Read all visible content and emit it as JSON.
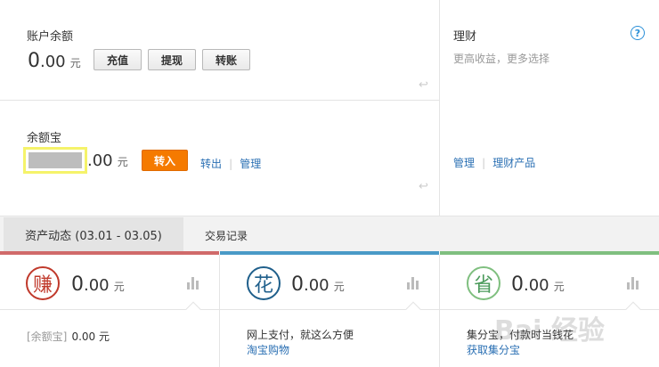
{
  "account": {
    "title": "账户余额",
    "amount_int": "0",
    "amount_dec": ".00",
    "unit": "元",
    "buttons": [
      "充值",
      "提现",
      "转账"
    ]
  },
  "yuebao": {
    "title": "余额宝",
    "amount_dec": ".00",
    "unit": "元",
    "transfer_in": "转入",
    "transfer_out": "转出",
    "manage": "管理",
    "separator": "|"
  },
  "licai": {
    "title": "理财",
    "subtitle": "更高收益，更多选择",
    "help": "?",
    "manage": "管理",
    "products": "理财产品",
    "separator": "|"
  },
  "tabs": {
    "active": "资产动态 (03.01 - 03.05)",
    "records": "交易记录"
  },
  "cards": [
    {
      "icon_char": "赚",
      "icon_color": "#c0392b",
      "bar_color": "#d06a6a",
      "amount_int": "0",
      "amount_dec": ".00",
      "unit": "元",
      "line1_muted": "[余额宝]",
      "line1": "0.00 元",
      "line2": ""
    },
    {
      "icon_char": "花",
      "icon_color": "#1f5f8b",
      "bar_color": "#4a9ac7",
      "amount_int": "0",
      "amount_dec": ".00",
      "unit": "元",
      "line1": "网上支付，就这么方便",
      "line2": "淘宝购物"
    },
    {
      "icon_char": "省",
      "icon_color": "#4a9a5a",
      "bar_color": "#7fbf7f",
      "amount_int": "0",
      "amount_dec": ".00",
      "unit": "元",
      "line1": "集分宝，付款时当钱花",
      "line2": "获取集分宝"
    }
  ],
  "icons": {
    "return": "return-arrow-icon",
    "bars": "bar-chart-icon"
  },
  "watermark": "Bai 经验"
}
